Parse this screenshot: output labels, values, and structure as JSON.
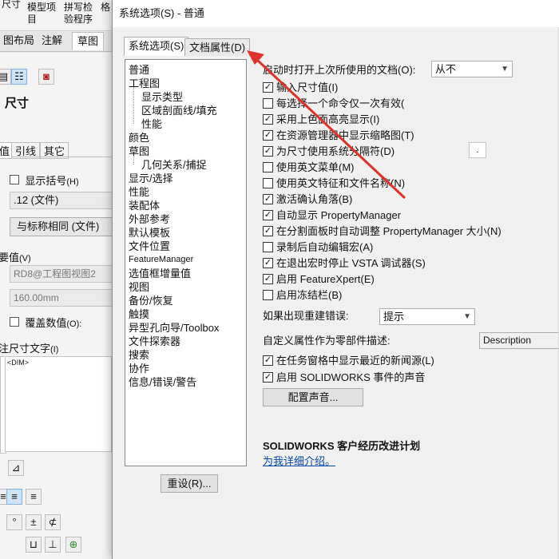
{
  "background": {
    "ribbon": {
      "items": [
        "尺寸",
        "模型项\n目",
        "拼写检\n验程序",
        "格"
      ]
    },
    "tabs": [
      "图布局",
      "注解",
      "草图"
    ],
    "panel": {
      "title": "尺寸",
      "subtabs": [
        "值",
        "引线",
        "其它"
      ],
      "show_brackets_label": "显示括号",
      "show_brackets_key": "(H)",
      "precision_value": ".12 (文件)",
      "same_as_nominal_btn": "与标称相同 (文件)",
      "primary_value_label": "要值",
      "primary_value_key": "(V)",
      "dim_ref_value": "RD8@工程图视图2",
      "dim_number": "160.00mm",
      "override_label": "覆盖数值",
      "override_key": "(O):",
      "dim_text_label": "注尺寸文字",
      "dim_text_key": "(I)",
      "dim_text_value": "<DIM>",
      "symbols": [
        "°",
        "±",
        "⊄",
        "⊔",
        "⊥",
        "⊕"
      ]
    }
  },
  "dialog": {
    "title": "系统选项(S) - 普通",
    "tabs": {
      "system_options": "系统选项(S)",
      "doc_properties": "文档属性(D)"
    },
    "tree": [
      {
        "label": "普通",
        "indent": 0,
        "selected": true
      },
      {
        "label": "工程图",
        "indent": 0
      },
      {
        "label": "显示类型",
        "indent": 1
      },
      {
        "label": "区域剖面线/填充",
        "indent": 1
      },
      {
        "label": "性能",
        "indent": 1
      },
      {
        "label": "颜色",
        "indent": 0
      },
      {
        "label": "草图",
        "indent": 0
      },
      {
        "label": "几何关系/捕捉",
        "indent": 1
      },
      {
        "label": "显示/选择",
        "indent": 0
      },
      {
        "label": "性能",
        "indent": 0
      },
      {
        "label": "装配体",
        "indent": 0
      },
      {
        "label": "外部参考",
        "indent": 0
      },
      {
        "label": "默认模板",
        "indent": 0
      },
      {
        "label": "文件位置",
        "indent": 0
      },
      {
        "label": "FeatureManager",
        "indent": 0,
        "small": true
      },
      {
        "label": "选值框增量值",
        "indent": 0
      },
      {
        "label": "视图",
        "indent": 0
      },
      {
        "label": "备份/恢复",
        "indent": 0
      },
      {
        "label": "触摸",
        "indent": 0
      },
      {
        "label": "异型孔向导/Toolbox",
        "indent": 0
      },
      {
        "label": "文件探索器",
        "indent": 0
      },
      {
        "label": "搜索",
        "indent": 0
      },
      {
        "label": "协作",
        "indent": 0
      },
      {
        "label": "信息/错误/警告",
        "indent": 0
      }
    ],
    "reset_btn": "重设(R)...",
    "open_last_label": "启动时打开上次所使用的文档(O):",
    "open_last_value": "从不",
    "options": [
      {
        "label": "输入尺寸值(I)",
        "checked": true
      },
      {
        "label": "每选择一个命令仅一次有效(",
        "checked": false
      },
      {
        "label": "采用上色面高亮显示(I)",
        "checked": true
      },
      {
        "label": "在资源管理器中显示缩略图(T)",
        "checked": true
      },
      {
        "label": "为尺寸使用系统分隔符(D)",
        "checked": true
      },
      {
        "label": "使用英文菜单(M)",
        "checked": false
      },
      {
        "label": "使用英文特征和文件名称(N)",
        "checked": false
      },
      {
        "label": "激活确认角落(B)",
        "checked": true
      },
      {
        "label": "自动显示 PropertyManager",
        "checked": true
      },
      {
        "label": "在分割面板时自动调整 PropertyManager 大小(N)",
        "checked": true
      },
      {
        "label": "录制后自动编辑宏(A)",
        "checked": false
      },
      {
        "label": "在退出宏时停止 VSTA 调试器(S)",
        "checked": true
      },
      {
        "label": "启用 FeatureXpert(E)",
        "checked": true
      },
      {
        "label": "启用冻结栏(B)",
        "checked": false
      }
    ],
    "separator_value": ".",
    "rebuild_error_label": "如果出现重建错误:",
    "rebuild_error_value": "提示",
    "custom_prop_label": "自定义属性作为零部件描述:",
    "custom_prop_value": "Description",
    "news_label": "在任务窗格中显示最近的新闻源(L)",
    "news_checked": true,
    "sound_label": "启用 SOLIDWORKS 事件的声音",
    "sound_checked": true,
    "config_sound_btn": "配置声音...",
    "ceip_title": "SOLIDWORKS 客户经历改进计划",
    "ceip_link": "为我详细介绍。",
    "annotation_color": "#e0312b"
  }
}
